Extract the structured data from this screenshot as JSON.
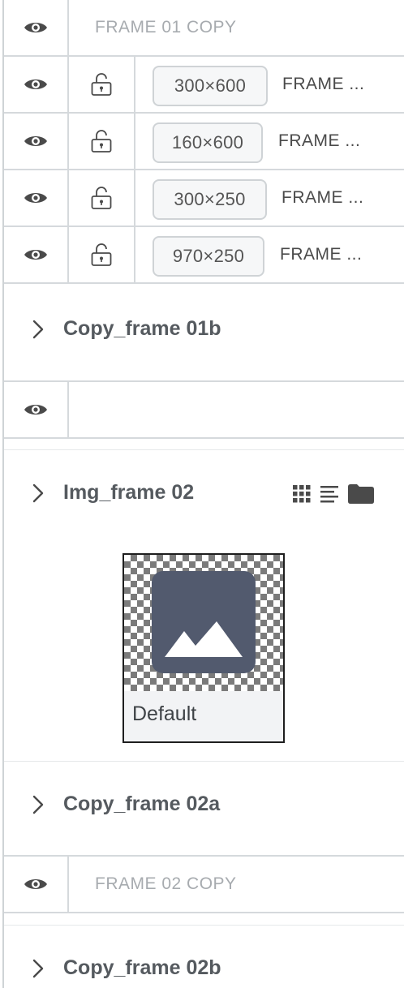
{
  "layers": {
    "frame01_copy_row": {
      "placeholder": "FRAME 01 COPY"
    },
    "frame01_size_rows": [
      {
        "size": "300×600",
        "label": "FRAME ..."
      },
      {
        "size": "160×600",
        "label": "FRAME ..."
      },
      {
        "size": "300×250",
        "label": "FRAME ..."
      },
      {
        "size": "970×250",
        "label": "FRAME ..."
      }
    ],
    "copy_frame_01b": {
      "title": "Copy_frame 01b"
    },
    "img_frame_02": {
      "title": "Img_frame 02",
      "thumbnail_caption": "Default"
    },
    "copy_frame_02a": {
      "title": "Copy_frame 02a"
    },
    "frame02_copy_row": {
      "placeholder": "FRAME 02 COPY"
    },
    "copy_frame_02b": {
      "title": "Copy_frame 02b"
    }
  },
  "icons": {
    "visibility": "eye-icon",
    "lock": "unlock-icon",
    "expand": "chevron-right-icon",
    "grid": "grid-icon",
    "list": "list-icon",
    "folder": "folder-icon",
    "image": "image-icon"
  },
  "colors": {
    "icon": "#4a4a4a",
    "border": "#d5d9dc",
    "placeholder_text": "#a7abaf",
    "image_tile": "#525a6e"
  }
}
